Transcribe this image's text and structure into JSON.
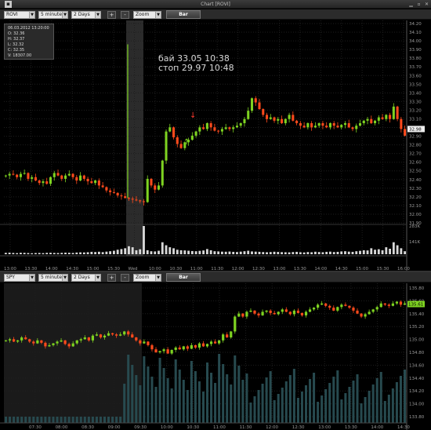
{
  "window": {
    "title": "Chart [ROVI]"
  },
  "panel1": {
    "symbol": "ROVI",
    "interval": "5 minutes",
    "range": "2 Days",
    "zoom": "Zoom",
    "chart_type_button": "Bar",
    "plus": "+",
    "minus": "-",
    "ohlc": {
      "date": "06.03.2012 13:20:00",
      "open": "O: 32.36",
      "high": "H: 32.37",
      "low": "L: 32.32",
      "close": "C: 32.35",
      "volume": "V: 18307.00"
    },
    "annotation_buy": "бай  33.05  10:38",
    "annotation_stop": "стоп  29.97  10:48",
    "last_price": "32.98",
    "volume_axis_labels": [
      "283K",
      "141K"
    ]
  },
  "panel2": {
    "symbol": "SPY",
    "interval": "5 minutes",
    "range": "2 Days",
    "zoom": "Zoom",
    "chart_type_button": "Bar",
    "plus": "+",
    "minus": "-",
    "last_price": "135.61"
  },
  "chart_data": [
    {
      "type": "candlestick",
      "symbol": "ROVI",
      "title": "",
      "y_ticks": [
        "34.20",
        "34.10",
        "34.00",
        "33.90",
        "33.80",
        "33.70",
        "33.60",
        "33.50",
        "33.40",
        "33.30",
        "33.20",
        "33.10",
        "33.00",
        "32.90",
        "32.80",
        "32.70",
        "32.60",
        "32.50",
        "32.40",
        "32.30",
        "32.20",
        "32.10",
        "32.00",
        "31.90"
      ],
      "x_ticks": [
        "13:00",
        "13:30",
        "14:00",
        "14:30",
        "15:00",
        "15:30",
        "Wed",
        "10:00",
        "10:30",
        "11:00",
        "11:30",
        "12:00",
        "12:30",
        "13:00",
        "13:30",
        "14:00",
        "14:30",
        "15:00",
        "15:30",
        "16:00"
      ],
      "ylim": [
        31.85,
        34.25
      ],
      "close_series": [
        32.42,
        32.44,
        32.43,
        32.4,
        32.44,
        32.45,
        32.38,
        32.4,
        32.36,
        32.33,
        32.35,
        32.32,
        32.4,
        32.45,
        32.42,
        32.38,
        32.42,
        32.44,
        32.4,
        32.36,
        32.42,
        32.38,
        32.35,
        32.33,
        32.36,
        32.3,
        32.28,
        32.24,
        32.22,
        32.21,
        32.18,
        32.17,
        32.15,
        32.14,
        32.13,
        32.12,
        32.11,
        32.1,
        32.38,
        32.3,
        32.25,
        32.3,
        32.6,
        32.95,
        33.0,
        32.88,
        32.8,
        32.75,
        32.82,
        32.85,
        32.9,
        32.95,
        33.0,
        32.98,
        33.05,
        33.0,
        32.96,
        32.95,
        32.98,
        33.0,
        32.98,
        33.0,
        33.02,
        33.05,
        33.1,
        33.2,
        33.35,
        33.3,
        33.22,
        33.15,
        33.1,
        33.12,
        33.08,
        33.1,
        33.05,
        33.1,
        33.15,
        33.08,
        33.05,
        33.02,
        33.0,
        33.05,
        33.0,
        33.02,
        33.05,
        33.02,
        33.0,
        33.05,
        33.02,
        33.0,
        33.03,
        33.05,
        33.0,
        32.98,
        33.02,
        33.05,
        33.08,
        33.1,
        33.05,
        33.08,
        33.12,
        33.1,
        33.15,
        33.1,
        33.25,
        33.1,
        32.98,
        32.9
      ],
      "volume_series": [
        14,
        16,
        13,
        11,
        15,
        14,
        12,
        10,
        12,
        13,
        11,
        14,
        15,
        13,
        12,
        14,
        16,
        15,
        13,
        17,
        19,
        18,
        20,
        24,
        22,
        25,
        21,
        26,
        30,
        35,
        45,
        52,
        60,
        80,
        70,
        40,
        50,
        283,
        40,
        30,
        28,
        35,
        120,
        90,
        70,
        60,
        45,
        40,
        38,
        35,
        32,
        30,
        34,
        38,
        52,
        40,
        30,
        28,
        26,
        25,
        27,
        24,
        22,
        26,
        30,
        35,
        28,
        26,
        24,
        22,
        20,
        22,
        25,
        23,
        21,
        20,
        19,
        22,
        24,
        20,
        18,
        22,
        20,
        25,
        22,
        20,
        24,
        26,
        22,
        24,
        28,
        30,
        26,
        24,
        30,
        34,
        40,
        38,
        60,
        45,
        50,
        40,
        70,
        55,
        120,
        90,
        60,
        30
      ],
      "annotations": [
        "бай  33.05  10:38",
        "стоп  29.97  10:48"
      ]
    },
    {
      "type": "candlestick",
      "symbol": "SPY",
      "title": "",
      "y_ticks": [
        "135.80",
        "135.60",
        "135.40",
        "135.20",
        "135.00",
        "134.80",
        "134.60",
        "134.40",
        "134.20",
        "134.00",
        "133.80"
      ],
      "x_ticks": [
        "07:30",
        "08:00",
        "08:30",
        "09:00",
        "09:30",
        "10:00",
        "10:30",
        "11:00",
        "11:30",
        "12:00",
        "12:30",
        "13:00",
        "13:30",
        "14:00",
        "14:30"
      ],
      "ylim": [
        133.72,
        135.88
      ],
      "close_series": [
        135.0,
        135.02,
        134.98,
        135.0,
        135.05,
        135.02,
        134.98,
        134.95,
        135.0,
        134.96,
        134.9,
        134.92,
        134.95,
        134.98,
        135.0,
        134.94,
        134.9,
        134.95,
        135.0,
        135.02,
        135.05,
        135.0,
        135.08,
        135.1,
        135.05,
        135.08,
        135.12,
        135.1,
        135.08,
        135.1,
        135.15,
        135.1,
        135.05,
        135.0,
        134.95,
        134.98,
        134.92,
        134.85,
        134.8,
        134.82,
        134.85,
        134.78,
        134.84,
        134.88,
        134.85,
        134.9,
        134.86,
        134.92,
        134.88,
        134.95,
        134.9,
        134.94,
        134.98,
        134.95,
        135.0,
        135.1,
        135.05,
        135.15,
        135.4,
        135.45,
        135.4,
        135.48,
        135.5,
        135.45,
        135.42,
        135.48,
        135.5,
        135.46,
        135.44,
        135.48,
        135.52,
        135.48,
        135.44,
        135.5,
        135.46,
        135.42,
        135.48,
        135.52,
        135.55,
        135.6,
        135.62,
        135.58,
        135.55,
        135.5,
        135.56,
        135.6,
        135.58,
        135.55,
        135.5,
        135.45,
        135.4,
        135.44,
        135.48,
        135.52,
        135.56,
        135.62,
        135.6,
        135.58,
        135.62,
        135.65,
        135.6,
        135.62
      ]
    }
  ]
}
